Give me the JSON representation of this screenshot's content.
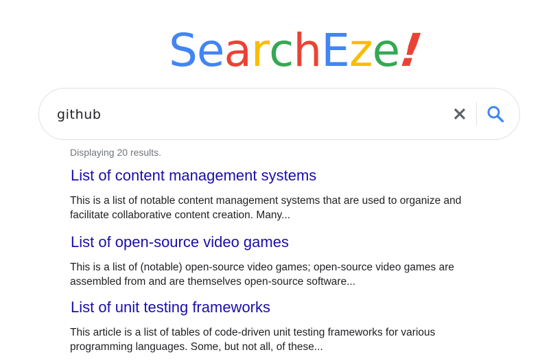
{
  "logo": {
    "letters": [
      {
        "char": "S",
        "color": "#4285f4"
      },
      {
        "char": "e",
        "color": "#4285f4"
      },
      {
        "char": "a",
        "color": "#ea4335"
      },
      {
        "char": "r",
        "color": "#fbbc05"
      },
      {
        "char": "c",
        "color": "#34a853"
      },
      {
        "char": "h",
        "color": "#ea4335"
      },
      {
        "char": "E",
        "color": "#4285f4"
      },
      {
        "char": "z",
        "color": "#fbbc05"
      },
      {
        "char": "e",
        "color": "#34a853"
      },
      {
        "char": "!",
        "color": "#ea4335"
      }
    ]
  },
  "search": {
    "value": "github",
    "clear_icon": "close-icon",
    "search_icon": "search-icon",
    "accent": "#4285f4"
  },
  "results": {
    "count_text": "Displaying 20 results.",
    "items": [
      {
        "title": "List of content management systems",
        "snippet": "This is a list of notable content management systems that are used to organize and facilitate collaborative content creation. Many..."
      },
      {
        "title": "List of open-source video games",
        "snippet": "This is a list of (notable) open-source video games; open-source video games are assembled from and are themselves open-source software..."
      },
      {
        "title": "List of unit testing frameworks",
        "snippet": "This article is a list of tables of code-driven unit testing frameworks for various programming languages. Some, but not all, of these..."
      }
    ]
  }
}
